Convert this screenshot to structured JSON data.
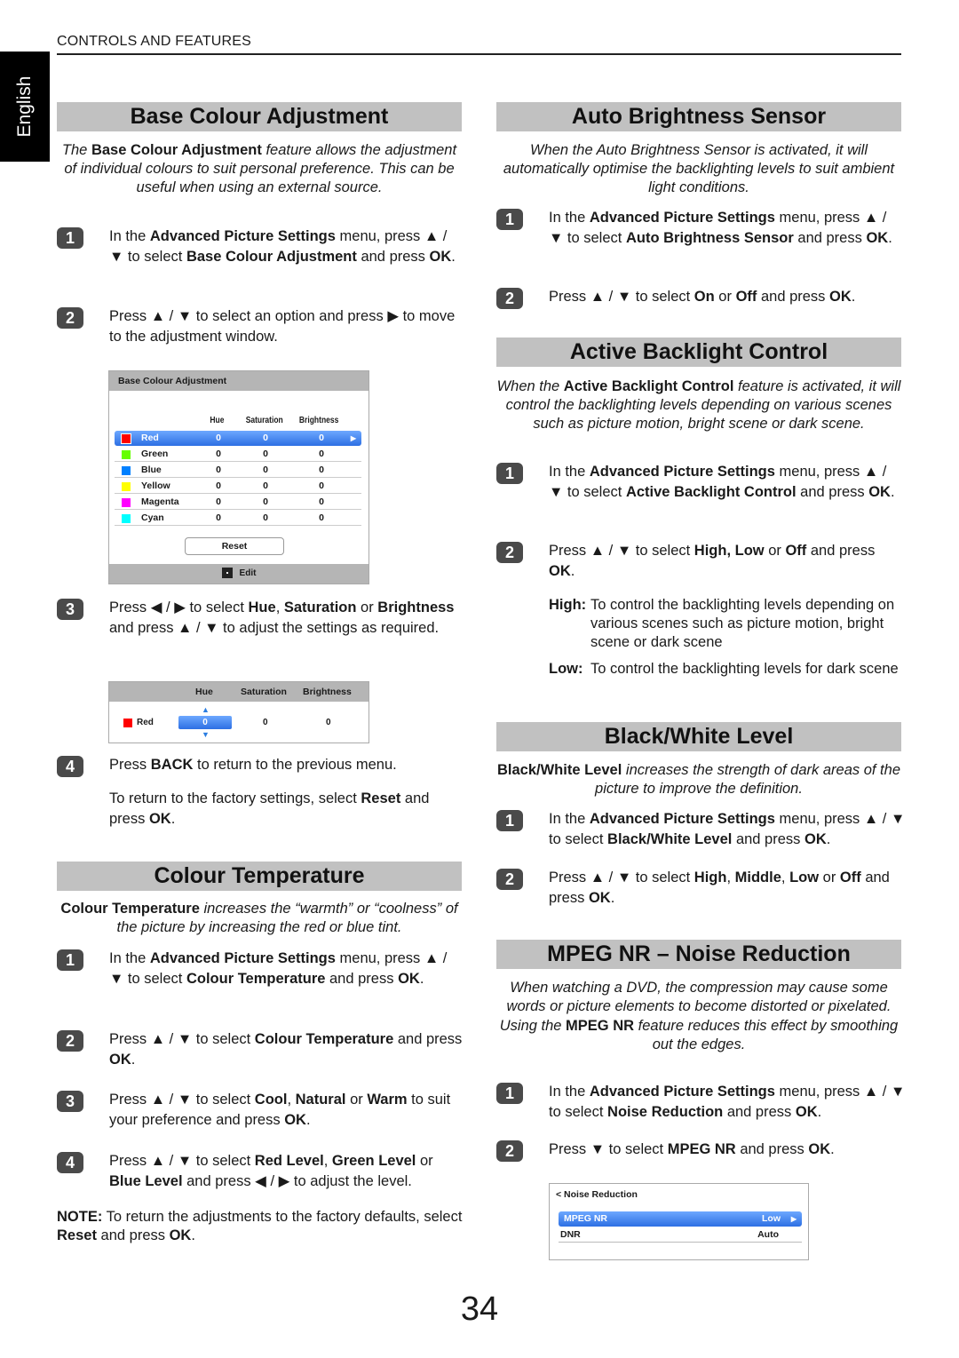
{
  "header": {
    "section": "CONTROLS AND FEATURES",
    "language_tab": "English"
  },
  "page_number": "34",
  "left": {
    "base_colour": {
      "title": "Base Colour Adjustment",
      "intro": {
        "pre": "The ",
        "bold": "Base Colour Adjustment",
        "post": " feature allows the adjustment of individual colours to suit personal preference. This can be useful when using an external source."
      },
      "steps": [
        {
          "num": "1",
          "parts": [
            "In the ",
            "Advanced Picture Settings",
            " menu, press ▲ / ▼ to select ",
            "Base Colour Adjustment",
            " and press ",
            "OK",
            "."
          ]
        },
        {
          "num": "2",
          "text": "Press ▲ / ▼ to select an option and press ▶ to move to the adjustment window."
        },
        {
          "num": "3",
          "parts": [
            "Press ◀ / ▶ to select ",
            "Hue",
            ", ",
            "Saturation",
            " or ",
            "Brightness",
            " and press ▲ / ▼ to adjust the settings as required."
          ]
        },
        {
          "num": "4",
          "parts": [
            "Press ",
            "BACK",
            " to return to the previous menu."
          ]
        }
      ],
      "after_step4": {
        "parts": [
          "To return to the factory settings, select ",
          "Reset",
          " and press ",
          "OK",
          "."
        ]
      },
      "osd": {
        "title": "Base Colour Adjustment",
        "columns": [
          "Hue",
          "Saturation",
          "Brightness"
        ],
        "rows": [
          {
            "name": "Red",
            "color": "#ff0000",
            "hue": "0",
            "saturation": "0",
            "brightness": "0",
            "selected": true
          },
          {
            "name": "Green",
            "color": "#66ff00",
            "hue": "0",
            "saturation": "0",
            "brightness": "0"
          },
          {
            "name": "Blue",
            "color": "#0080ff",
            "hue": "0",
            "saturation": "0",
            "brightness": "0"
          },
          {
            "name": "Yellow",
            "color": "#ffff00",
            "hue": "0",
            "saturation": "0",
            "brightness": "0"
          },
          {
            "name": "Magenta",
            "color": "#ff00ff",
            "hue": "0",
            "saturation": "0",
            "brightness": "0"
          },
          {
            "name": "Cyan",
            "color": "#00ffff",
            "hue": "0",
            "saturation": "0",
            "brightness": "0"
          }
        ],
        "reset_label": "Reset",
        "footer_label": "Edit"
      },
      "adjust_osd": {
        "columns": [
          "Hue",
          "Saturation",
          "Brightness"
        ],
        "row": {
          "name": "Red",
          "color": "#ff0000",
          "hue": "0",
          "saturation": "0",
          "brightness": "0"
        }
      }
    },
    "colour_temp": {
      "title": "Colour Temperature",
      "intro": {
        "bold": "Colour Temperature",
        "post": " increases the “warmth” or “coolness” of the picture by increasing the red or blue tint."
      },
      "steps": [
        {
          "num": "1",
          "parts": [
            "In the ",
            "Advanced Picture Settings",
            " menu, press ▲ / ▼ to select ",
            "Colour Temperature",
            " and press ",
            "OK",
            "."
          ]
        },
        {
          "num": "2",
          "parts": [
            "Press ▲ / ▼ to select ",
            "Colour Temperature",
            " and press ",
            "OK",
            "."
          ]
        },
        {
          "num": "3",
          "parts": [
            "Press ▲ / ▼ to select ",
            "Cool",
            ", ",
            "Natural",
            " or ",
            "Warm",
            " to suit your preference and press ",
            "OK",
            "."
          ]
        },
        {
          "num": "4",
          "parts": [
            "Press ▲ / ▼ to select ",
            "Red Level",
            ", ",
            "Green Level",
            " or ",
            "Blue Level",
            " and press ◀ / ▶ to adjust the level."
          ]
        }
      ],
      "note": {
        "parts": [
          "NOTE:",
          " To return the adjustments to the factory defaults, select ",
          "Reset",
          " and press ",
          "OK",
          "."
        ]
      }
    }
  },
  "right": {
    "auto_brightness": {
      "title": "Auto Brightness Sensor",
      "intro": "When the Auto Brightness Sensor is activated, it will automatically optimise the backlighting levels to suit ambient light conditions.",
      "steps": [
        {
          "num": "1",
          "parts": [
            "In the ",
            "Advanced Picture Settings",
            " menu, press ▲ / ▼ to select ",
            "Auto Brightness Sensor",
            " and press ",
            "OK",
            "."
          ]
        },
        {
          "num": "2",
          "parts": [
            "Press ▲ / ▼ to select ",
            "On",
            " or ",
            "Off",
            " and press ",
            "OK",
            "."
          ]
        }
      ]
    },
    "active_backlight": {
      "title": "Active Backlight Control",
      "intro": {
        "pre": "When the ",
        "bold": "Active Backlight Control",
        "post": " feature is activated, it will control the backlighting levels depending on various scenes such as picture motion, bright scene or dark scene."
      },
      "steps": [
        {
          "num": "1",
          "parts": [
            "In the ",
            "Advanced Picture Settings",
            " menu, press ▲ / ▼ to select ",
            "Active Backlight Control",
            " and press ",
            "OK",
            "."
          ]
        },
        {
          "num": "2",
          "parts": [
            "Press ▲ / ▼ to select ",
            "High, Low",
            " or ",
            "Off",
            " and press ",
            "OK",
            "."
          ]
        }
      ],
      "definitions": [
        {
          "term": "High:",
          "text": "To control the backlighting levels depending on various scenes such as picture motion, bright scene or dark scene"
        },
        {
          "term": "Low:",
          "text": "To control the backlighting levels for dark scene"
        }
      ]
    },
    "bw_level": {
      "title": "Black/White Level",
      "intro": {
        "bold": "Black/White Level",
        "post": " increases the strength of dark areas of the picture to improve the definition."
      },
      "steps": [
        {
          "num": "1",
          "parts": [
            "In the ",
            "Advanced Picture Settings",
            " menu, press ▲ / ▼ to select ",
            "Black/White Level",
            " and press ",
            "OK",
            "."
          ]
        },
        {
          "num": "2",
          "parts": [
            "Press ▲ / ▼ to select ",
            "High",
            ", ",
            "Middle",
            ", ",
            "Low",
            " or ",
            "Off",
            " and press ",
            "OK",
            "."
          ]
        }
      ]
    },
    "mpeg_nr": {
      "title": "MPEG NR – Noise Reduction",
      "intro": {
        "line1": "When watching a DVD, the compression may cause some words or picture elements to become distorted or pixelated.",
        "pre": "Using the ",
        "bold": "MPEG NR",
        "post": " feature reduces this effect by smoothing out the edges."
      },
      "steps": [
        {
          "num": "1",
          "parts": [
            "In the ",
            "Advanced Picture Settings",
            " menu, press ▲ / ▼ to select ",
            "Noise Reduction",
            " and press ",
            "OK",
            "."
          ]
        },
        {
          "num": "2",
          "parts": [
            "Press ▼ to select ",
            "MPEG NR",
            " and press ",
            "OK",
            "."
          ]
        }
      ],
      "osd": {
        "title": "< Noise Reduction",
        "rows": [
          {
            "name": "MPEG NR",
            "value": "Low",
            "selected": true
          },
          {
            "name": "DNR",
            "value": "Auto"
          }
        ]
      }
    }
  }
}
